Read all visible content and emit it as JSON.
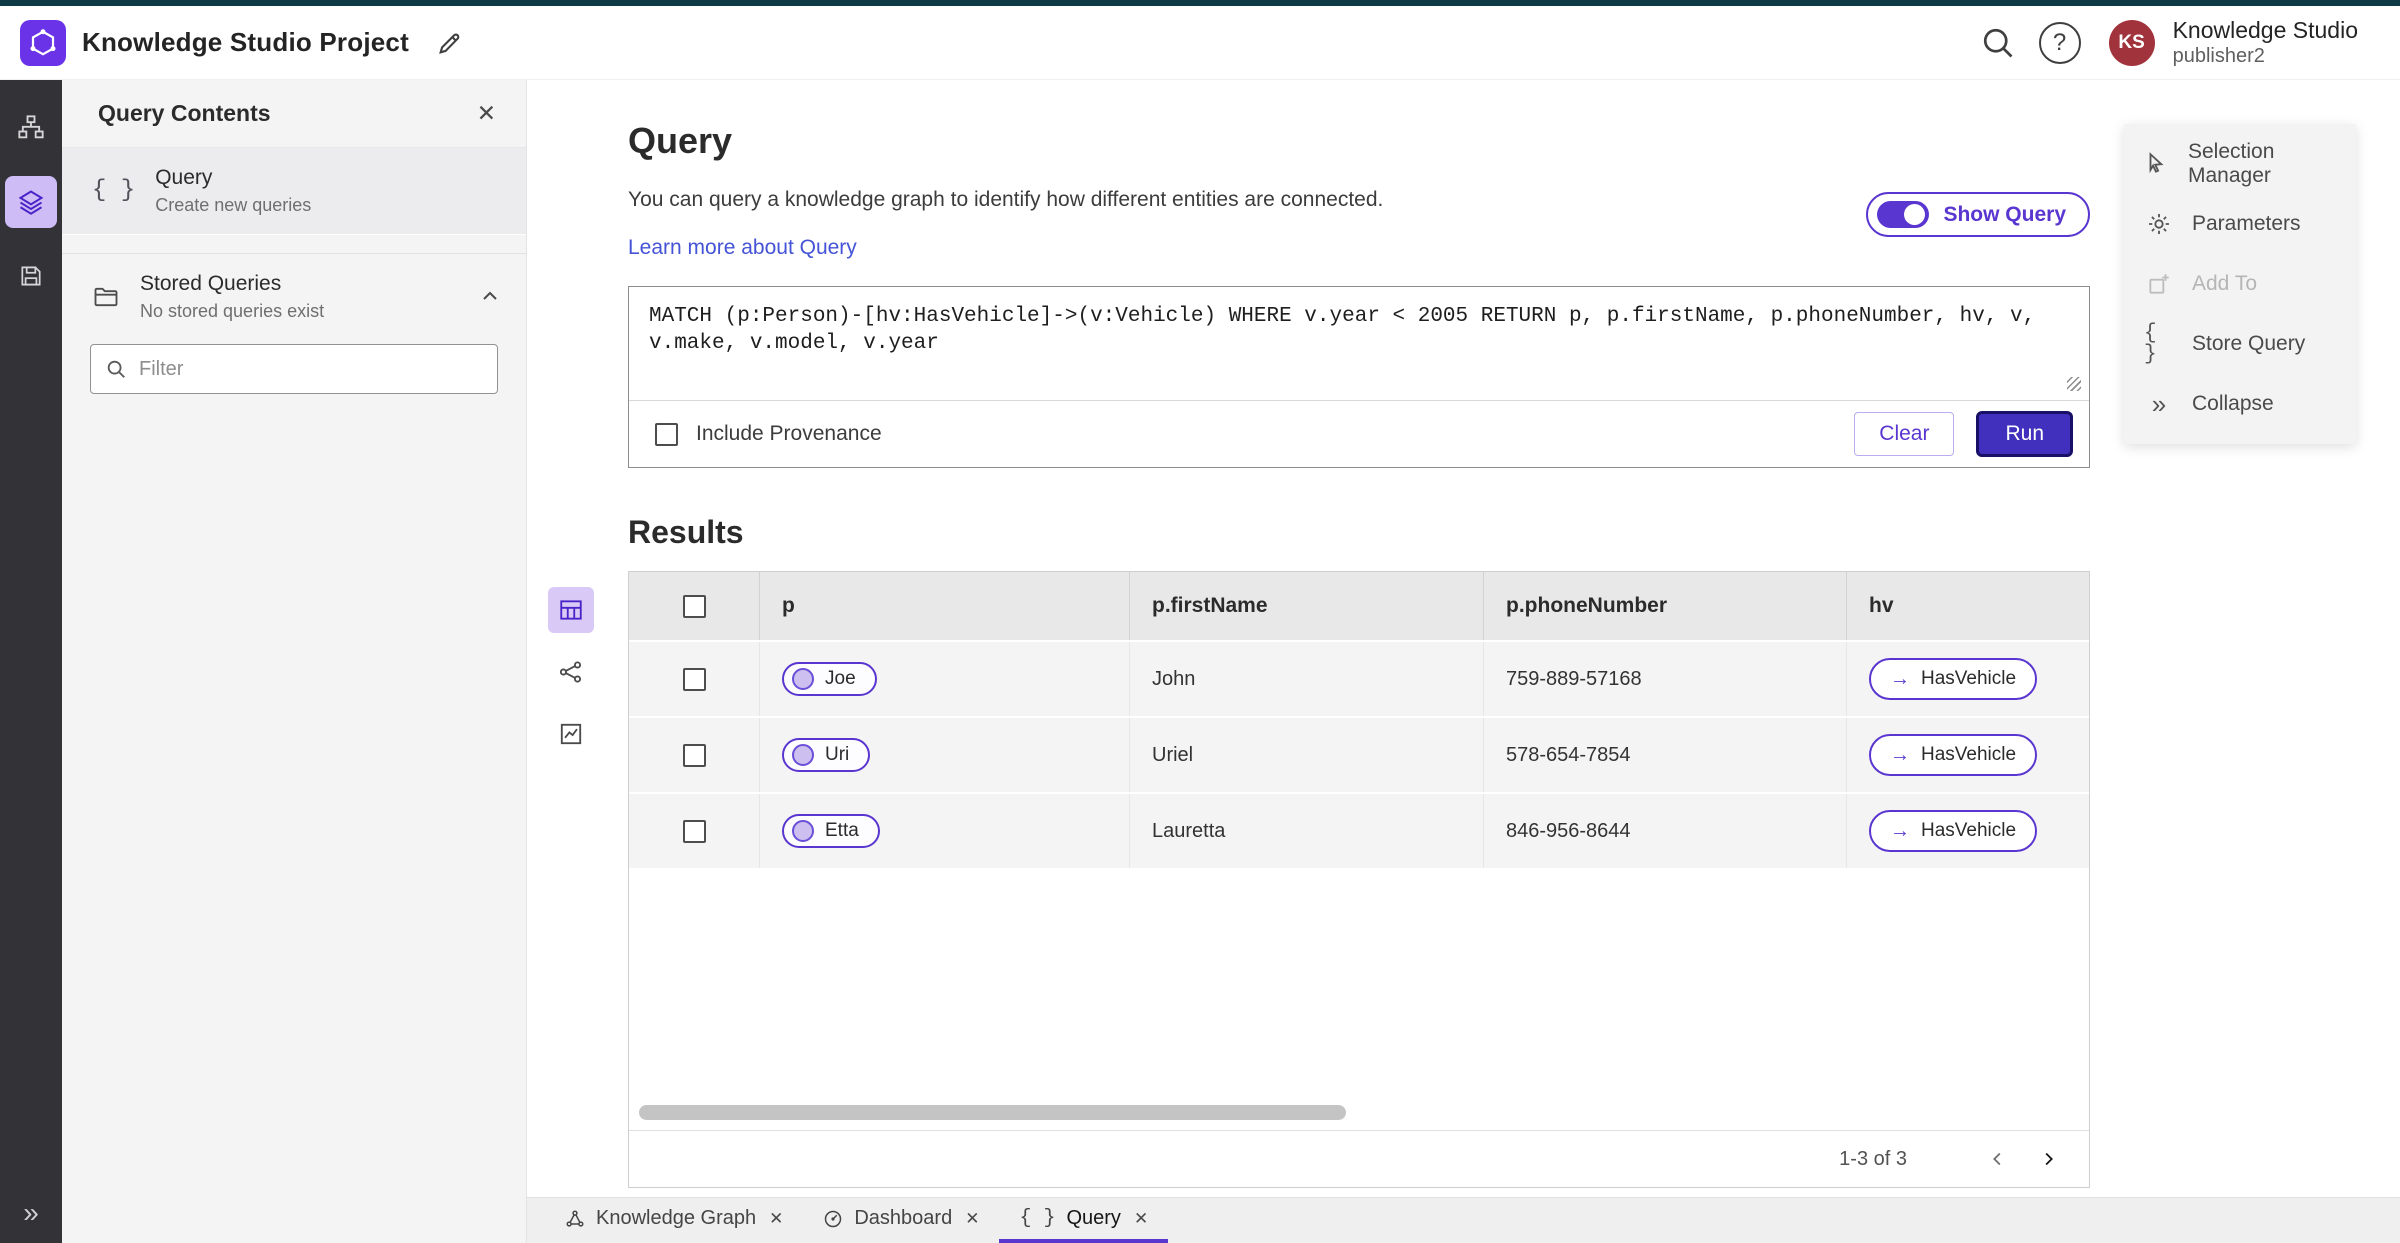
{
  "header": {
    "title": "Knowledge Studio Project",
    "product": "Knowledge Studio",
    "user_role": "publisher2",
    "avatar_initials": "KS"
  },
  "left_panel": {
    "title": "Query Contents",
    "query_item": {
      "title": "Query",
      "subtitle": "Create new queries"
    },
    "stored": {
      "title": "Stored Queries",
      "subtitle": "No stored queries exist"
    },
    "filter_placeholder": "Filter"
  },
  "main": {
    "title": "Query",
    "description": "You can query a knowledge graph to identify how different entities are connected.",
    "learn_link": "Learn more about Query",
    "show_query_label": "Show Query",
    "query_text": "MATCH (p:Person)-[hv:HasVehicle]->(v:Vehicle) WHERE v.year < 2005 RETURN p, p.firstName, p.phoneNumber, hv, v, v.make, v.model, v.year",
    "include_provenance_label": "Include Provenance",
    "clear_label": "Clear",
    "run_label": "Run",
    "results_title": "Results"
  },
  "table": {
    "columns": [
      "p",
      "p.firstName",
      "p.phoneNumber",
      "hv"
    ],
    "rows": [
      {
        "p": "Joe",
        "firstName": "John",
        "phone": "759-889-57168",
        "hv": "HasVehicle"
      },
      {
        "p": "Uri",
        "firstName": "Uriel",
        "phone": "578-654-7854",
        "hv": "HasVehicle"
      },
      {
        "p": "Etta",
        "firstName": "Lauretta",
        "phone": "846-956-8644",
        "hv": "HasVehicle"
      }
    ],
    "pagination": "1-3 of 3"
  },
  "right_menu": {
    "items": [
      {
        "label": "Selection Manager",
        "icon": "selection-manager-icon",
        "disabled": false
      },
      {
        "label": "Parameters",
        "icon": "gear-icon",
        "disabled": false
      },
      {
        "label": "Add To",
        "icon": "add-to-icon",
        "disabled": true
      },
      {
        "label": "Store Query",
        "icon": "braces-icon",
        "disabled": false
      },
      {
        "label": "Collapse",
        "icon": "collapse-icon",
        "disabled": false
      }
    ]
  },
  "tabs": [
    {
      "label": "Knowledge Graph",
      "icon": "graph-icon",
      "active": false
    },
    {
      "label": "Dashboard",
      "icon": "dashboard-icon",
      "active": false
    },
    {
      "label": "Query",
      "icon": "braces-icon",
      "active": true
    }
  ],
  "icons": {
    "close": "✕",
    "braces": "{ }",
    "collapse": "»",
    "arrow": "→",
    "help": "?"
  },
  "colors": {
    "accent_purple": "#5a36d0",
    "run_button": "#4130bd",
    "rail_bg": "#323237",
    "panel_bg": "#f4f4f4",
    "avatar_bg": "#a1333c",
    "link_blue": "#4553d6"
  }
}
